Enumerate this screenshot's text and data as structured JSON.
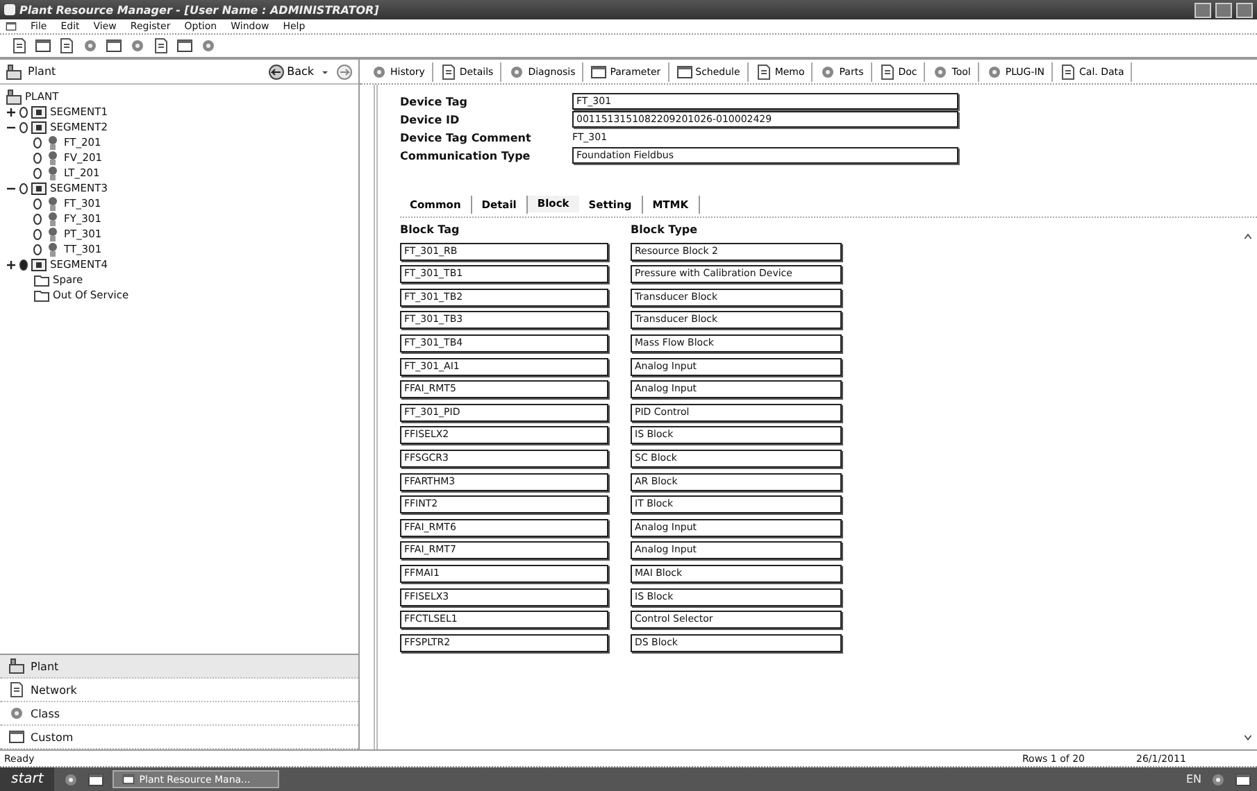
{
  "window": {
    "title": "Plant Resource Manager - [User Name : ADMINISTRATOR]"
  },
  "menu": [
    "File",
    "Edit",
    "View",
    "Register",
    "Option",
    "Window",
    "Help"
  ],
  "tree": {
    "header": "Plant",
    "back": "Back",
    "root": {
      "label": "PLANT",
      "kind": "plant",
      "children": [
        {
          "label": "SEGMENT1",
          "kind": "segment",
          "alarm": false,
          "expanded": false
        },
        {
          "label": "SEGMENT2",
          "kind": "segment",
          "alarm": false,
          "expanded": true,
          "children": [
            {
              "label": "FT_201",
              "kind": "device",
              "alarm": false
            },
            {
              "label": "FV_201",
              "kind": "device",
              "alarm": false
            },
            {
              "label": "LT_201",
              "kind": "device",
              "alarm": false
            }
          ]
        },
        {
          "label": "SEGMENT3",
          "kind": "segment",
          "alarm": false,
          "expanded": true,
          "children": [
            {
              "label": "FT_301",
              "kind": "device",
              "alarm": false
            },
            {
              "label": "FY_301",
              "kind": "device",
              "alarm": false
            },
            {
              "label": "PT_301",
              "kind": "device",
              "alarm": false
            },
            {
              "label": "TT_301",
              "kind": "device",
              "alarm": false
            }
          ]
        },
        {
          "label": "SEGMENT4",
          "kind": "segment",
          "alarm": true,
          "expanded": false
        },
        {
          "label": "Spare",
          "kind": "folder"
        },
        {
          "label": "Out Of Service",
          "kind": "folder"
        }
      ]
    }
  },
  "navigation": [
    {
      "label": "Plant",
      "selected": true
    },
    {
      "label": "Network",
      "selected": false
    },
    {
      "label": "Class",
      "selected": false
    },
    {
      "label": "Custom",
      "selected": false
    }
  ],
  "toolbar": [
    "History",
    "Details",
    "Diagnosis",
    "Parameter",
    "Schedule",
    "Memo",
    "Parts",
    "Doc",
    "Tool",
    "PLUG-IN",
    "Cal. Data"
  ],
  "device": [
    {
      "label": "Device Tag",
      "value": "FT_301",
      "kind": "field"
    },
    {
      "label": "Device ID",
      "value": "0011513151082209201026-010002429",
      "kind": "field"
    },
    {
      "label": "Device Tag Comment",
      "value": "FT_301",
      "kind": "text"
    },
    {
      "label": "Communication Type",
      "value": "Foundation Fieldbus",
      "kind": "field"
    }
  ],
  "tabs": [
    {
      "label": "Common",
      "selected": false
    },
    {
      "label": "Detail",
      "selected": false
    },
    {
      "label": "Block",
      "selected": true
    },
    {
      "label": "Setting",
      "selected": false
    },
    {
      "label": "MTMK",
      "selected": false
    }
  ],
  "blocks": {
    "columns": [
      "Block Tag",
      "Block Type"
    ],
    "rows": [
      [
        "FT_301_RB",
        "Resource Block 2"
      ],
      [
        "FT_301_TB1",
        "Pressure with Calibration Device"
      ],
      [
        "FT_301_TB2",
        "Transducer Block"
      ],
      [
        "FT_301_TB3",
        "Transducer Block"
      ],
      [
        "FT_301_TB4",
        "Mass Flow Block"
      ],
      [
        "FT_301_AI1",
        "Analog Input"
      ],
      [
        "FFAI_RMT5",
        "Analog Input"
      ],
      [
        "FT_301_PID",
        "PID Control"
      ],
      [
        "FFISELX2",
        "IS Block"
      ],
      [
        "FFSGCR3",
        "SC Block"
      ],
      [
        "FFARTHM3",
        "AR Block"
      ],
      [
        "FFINT2",
        "IT Block"
      ],
      [
        "FFAI_RMT6",
        "Analog Input"
      ],
      [
        "FFAI_RMT7",
        "Analog Input"
      ],
      [
        "FFMAI1",
        "MAI Block"
      ],
      [
        "FFISELX3",
        "IS Block"
      ],
      [
        "FFCTLSEL1",
        "Control Selector"
      ],
      [
        "FFSPLTR2",
        "DS Block"
      ]
    ]
  },
  "status_bar": {
    "message": "Ready",
    "rows": "Rows 1 of 20",
    "date": "26/1/2011"
  },
  "taskbar": {
    "start": "start",
    "task": "Plant Resource Mana...",
    "language": "EN"
  }
}
